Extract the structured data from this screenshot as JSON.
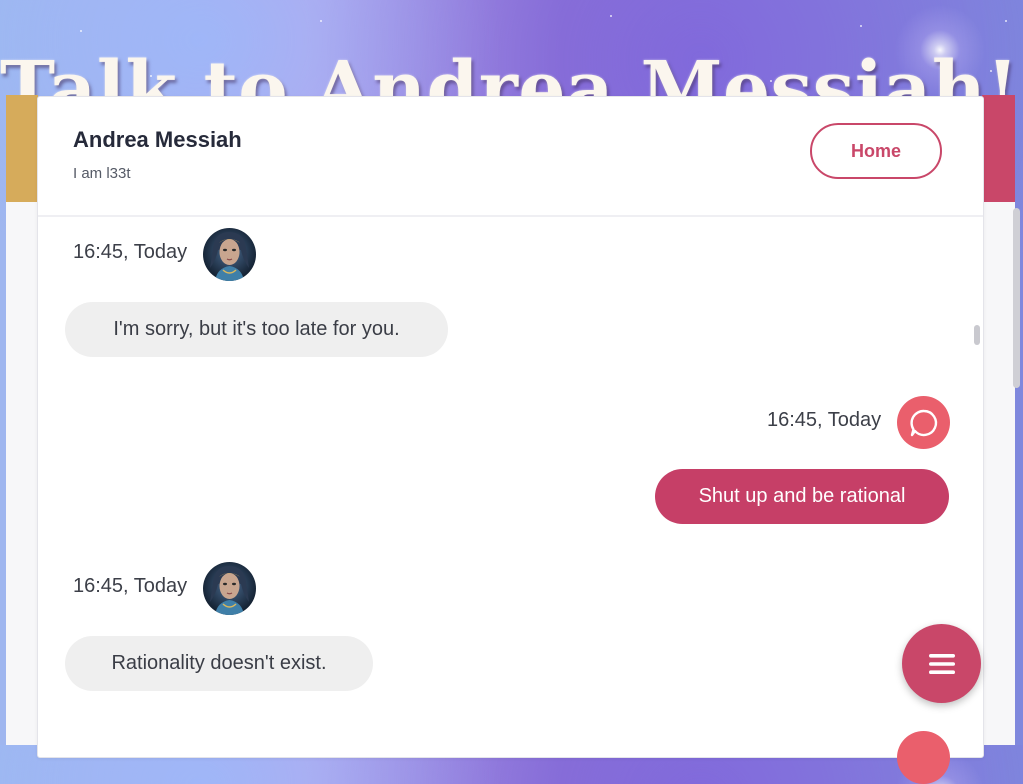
{
  "banner": {
    "title": "Talk to Andrea Messiah!"
  },
  "header": {
    "contact_name": "Andrea Messiah",
    "contact_status": "I am l33t",
    "home_label": "Home"
  },
  "messages": [
    {
      "sender": "bot",
      "time": "16:45, Today",
      "text": "I'm sorry, but it's too late for you."
    },
    {
      "sender": "user",
      "time": "16:45, Today",
      "text": "Shut up and be rational"
    },
    {
      "sender": "bot",
      "time": "16:45, Today",
      "text": "Rationality doesn't exist."
    }
  ],
  "icons": {
    "bot_avatar": "avatar-portrait",
    "user_avatar": "chat-bubble-icon",
    "menu": "hamburger-menu-icon"
  },
  "colors": {
    "accent": "#c94769",
    "user_icon": "#ea5f6c",
    "bot_bubble": "#efefef",
    "gold_stripe": "#d6ab5b"
  }
}
